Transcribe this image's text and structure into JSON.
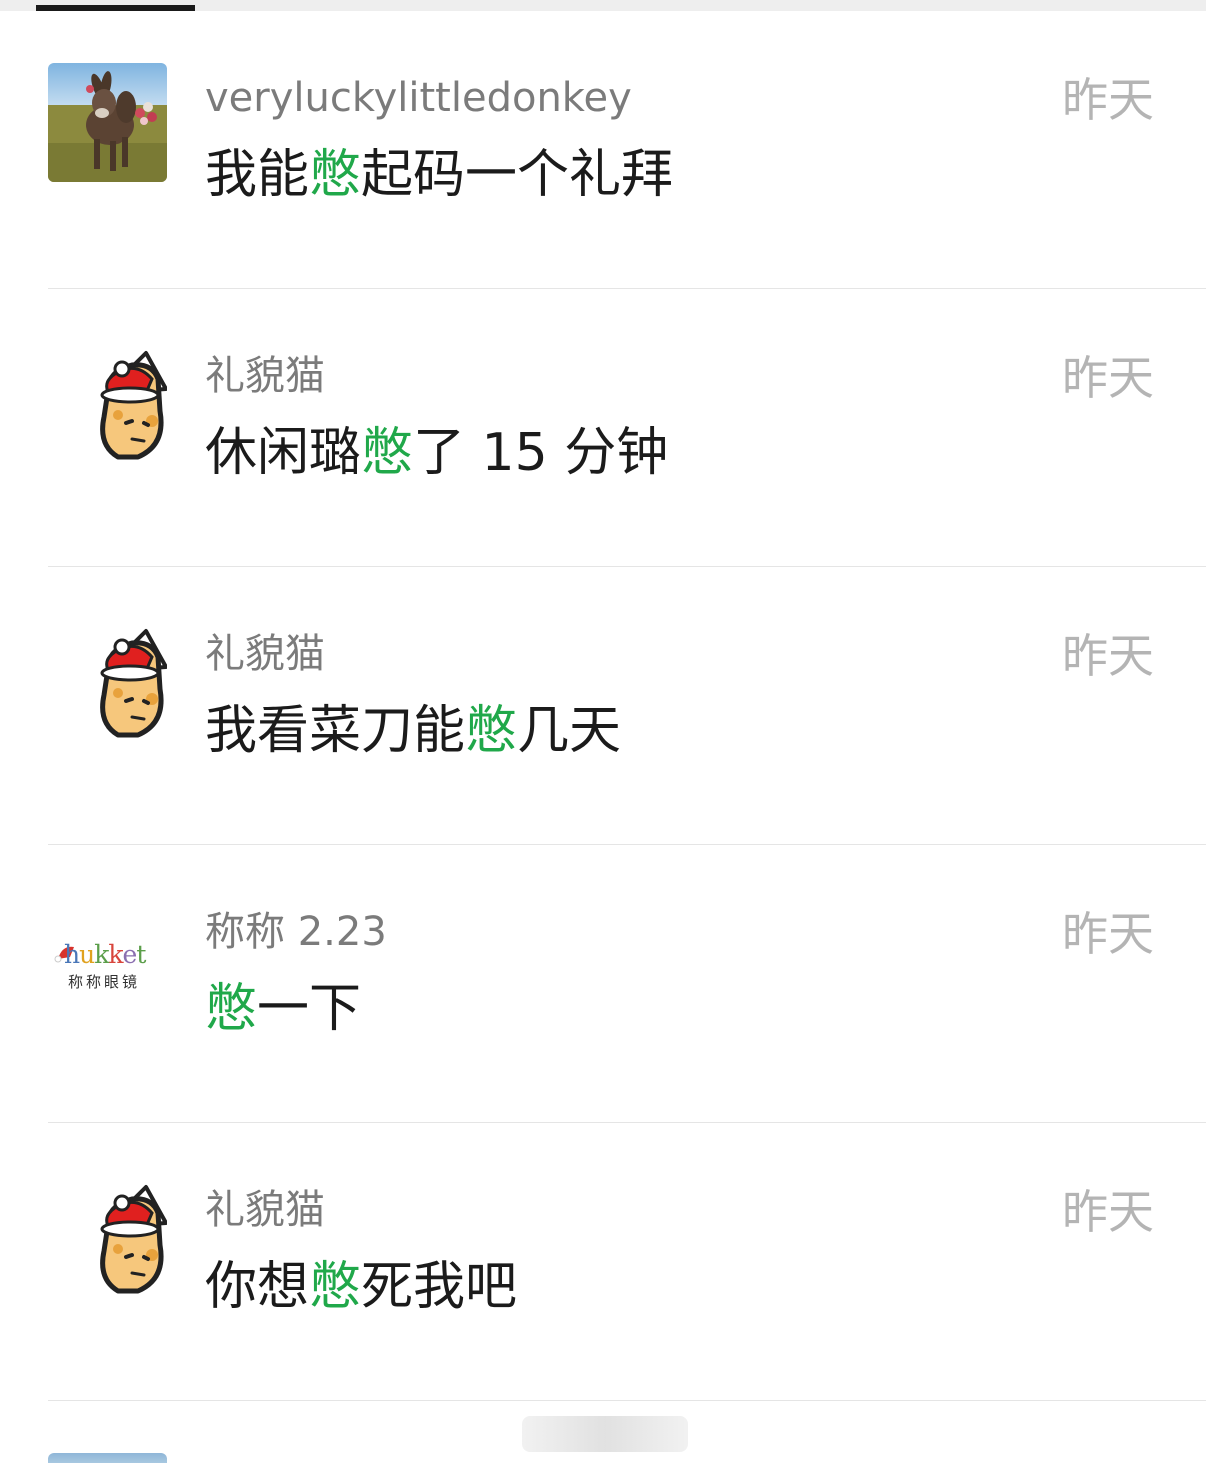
{
  "comments": [
    {
      "username": "veryluckylittledonkey",
      "time": "昨天",
      "avatar": "donkey-photo-avatar",
      "text_before": "我能",
      "highlight": "憋",
      "text_after": "起码一个礼拜"
    },
    {
      "username": "礼貌猫",
      "time": "昨天",
      "avatar": "cat-santa-hat-avatar",
      "text_before": "休闲璐",
      "highlight": "憋",
      "text_after": "了 15 分钟"
    },
    {
      "username": "礼貌猫",
      "time": "昨天",
      "avatar": "cat-santa-hat-avatar",
      "text_before": "我看菜刀能",
      "highlight": "憋",
      "text_after": "几天"
    },
    {
      "username": "称称 2.23",
      "time": "昨天",
      "avatar": "hukket-logo-avatar",
      "avatar_text": "hukket",
      "avatar_subtext": "称称眼镜",
      "text_before": "",
      "highlight": "憋",
      "text_after": "一下"
    },
    {
      "username": "礼貌猫",
      "time": "昨天",
      "avatar": "cat-santa-hat-avatar",
      "text_before": "你想",
      "highlight": "憋",
      "text_after": "死我吧"
    }
  ],
  "colors": {
    "highlight": "#20a84a",
    "username": "#7b7b7b",
    "time": "#b4b4b4",
    "body_text": "#1b1b1b",
    "divider": "#e5e5e5"
  }
}
